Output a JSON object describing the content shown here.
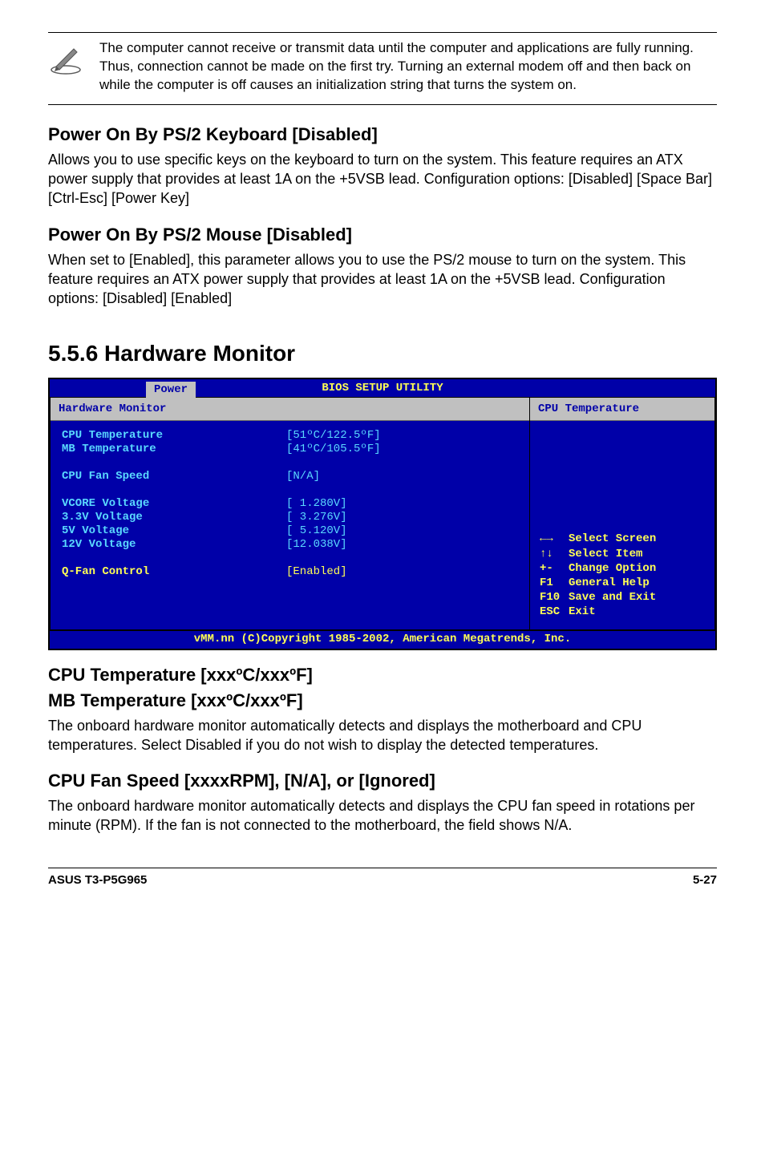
{
  "note": {
    "text": "The computer cannot receive or transmit data until the computer and applications are fully running. Thus, connection cannot be made on the first try. Turning an external modem off and then back on while the computer is off causes an initialization string that turns the system on."
  },
  "sections": {
    "ps2kb": {
      "heading": "Power On By PS/2 Keyboard [Disabled]",
      "body": "Allows you to use specific keys on the keyboard to turn on the system. This feature requires an ATX power supply that provides at least 1A on the +5VSB lead. Configuration options: [Disabled] [Space Bar] [Ctrl-Esc] [Power Key]"
    },
    "ps2mouse": {
      "heading": "Power On By PS/2 Mouse [Disabled]",
      "body": "When set to [Enabled], this parameter allows you to use the PS/2 mouse to turn on the system. This feature requires an ATX power supply that provides at least 1A on the +5VSB lead. Configuration options: [Disabled] [Enabled]"
    },
    "hwmon": {
      "heading": "5.5.6   Hardware Monitor"
    },
    "cputemp": {
      "heading1": "CPU Temperature [xxxºC/xxxºF]",
      "heading2": "MB Temperature [xxxºC/xxxºF]",
      "body": "The onboard hardware monitor automatically detects and displays the motherboard and CPU temperatures. Select Disabled if you do not wish to display the detected temperatures."
    },
    "fanspeed": {
      "heading": "CPU Fan Speed [xxxxRPM], [N/A], or [Ignored]",
      "body": "The onboard hardware monitor automatically detects and displays the CPU fan speed in rotations per minute (RPM). If the fan is not connected to the motherboard, the field shows N/A."
    }
  },
  "bios": {
    "title": "BIOS SETUP UTILITY",
    "tab": "Power",
    "section_title": "Hardware Monitor",
    "right_title": "CPU Temperature",
    "rows": [
      {
        "label": "CPU Temperature",
        "value": "[51ºC/122.5ºF]"
      },
      {
        "label": "MB Temperature",
        "value": "[41ºC/105.5ºF]"
      },
      {
        "label": "",
        "value": ""
      },
      {
        "label": "CPU Fan Speed",
        "value": "[N/A]"
      },
      {
        "label": "",
        "value": ""
      },
      {
        "label": "VCORE Voltage",
        "value": "[ 1.280V]"
      },
      {
        "label": "3.3V Voltage",
        "value": "[ 3.276V]"
      },
      {
        "label": "5V Voltage",
        "value": "[ 5.120V]"
      },
      {
        "label": "12V Voltage",
        "value": "[12.038V]"
      },
      {
        "label": "",
        "value": ""
      },
      {
        "label": "Q-Fan Control",
        "value": "[Enabled]"
      }
    ],
    "help": [
      {
        "sym": "←→",
        "text": "Select Screen"
      },
      {
        "sym": "↑↓",
        "text": "Select Item"
      },
      {
        "sym": "+-",
        "text": "Change Option"
      },
      {
        "sym": "F1",
        "text": "General Help"
      },
      {
        "sym": "F10",
        "text": "Save and Exit"
      },
      {
        "sym": "ESC",
        "text": "Exit"
      }
    ],
    "footer": "vMM.nn (C)Copyright 1985-2002, American Megatrends, Inc."
  },
  "page_footer": {
    "left": "ASUS T3-P5G965",
    "right": "5-27"
  }
}
